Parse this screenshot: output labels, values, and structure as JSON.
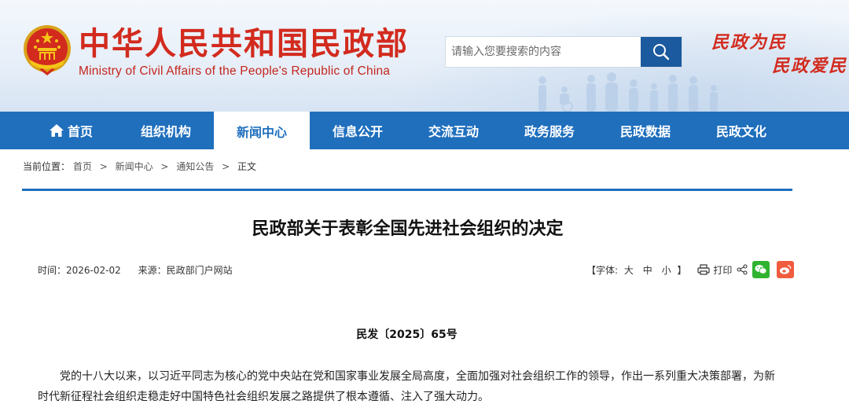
{
  "header": {
    "site_title": "中华人民共和国民政部",
    "site_subtitle": "Ministry of Civil Affairs of the People's Republic of China",
    "search_placeholder": "请输入您要搜索的内容",
    "slogan_line1": "民政为民",
    "slogan_line2": "民政爱民"
  },
  "nav": {
    "items": [
      {
        "label": "首页",
        "icon": "home-icon"
      },
      {
        "label": "组织机构"
      },
      {
        "label": "新闻中心",
        "active": true
      },
      {
        "label": "信息公开"
      },
      {
        "label": "交流互动"
      },
      {
        "label": "政务服务"
      },
      {
        "label": "民政数据"
      },
      {
        "label": "民政文化"
      }
    ]
  },
  "breadcrumb": {
    "prefix": "当前位置：",
    "items": [
      "首页",
      "新闻中心",
      "通知公告",
      "正文"
    ]
  },
  "article": {
    "title": "民政部关于表彰全国先进社会组织的决定",
    "time_label": "时间：",
    "time": "2026-02-02",
    "source_label": "来源：",
    "source": "民政部门户网站",
    "font_size_open": "【字体:",
    "font_large": "大",
    "font_medium": "中",
    "font_small": "小",
    "font_size_close": "】",
    "print_label": "打印",
    "doc_number": "民发〔2025〕65号",
    "paragraph": "党的十八大以来，以习近平同志为核心的党中央站在党和国家事业发展全局高度，全面加强对社会组织工作的领导，作出一系列重大决策部署，为新时代新征程社会组织走稳走好中国特色社会组织发展之路提供了根本遵循、注入了强大动力。"
  },
  "colors": {
    "brand_red": "#d22b1e",
    "nav_blue": "#1f6fbd",
    "search_button": "#1b5a9e",
    "wechat_green": "#2fb32f",
    "weibo_orange": "#f15b3e"
  }
}
